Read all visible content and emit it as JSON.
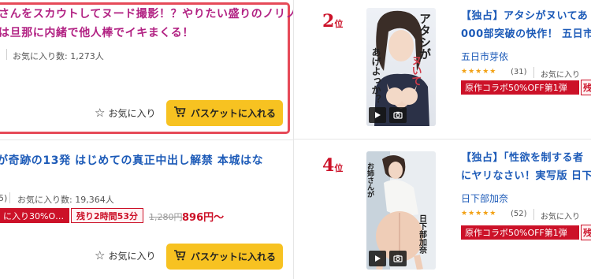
{
  "left_items": [
    {
      "title_line1": "さんをスカウトしてヌード撮影！？やりたい盛りのノリノ",
      "title_line2": "は旦那に内緒で他人棒でイキまくる！",
      "fav_count_label": "お気に入り数: 1,273人",
      "fav_button_label": "お気に入り",
      "basket_label": "バスケットに入れる"
    },
    {
      "title_line1": "が奇跡の13発 はじめての真正中出し解禁 本城はな",
      "rating_count_fragment": "5)",
      "fav_count_label": "お気に入り数: 19,364人",
      "discount_badge": "に入り30%O…",
      "time_left_badge": "残り2時間53分",
      "original_price": "1,280円",
      "sale_price": "896円〜",
      "fav_button_label": "お気に入り",
      "basket_label": "バスケットに入れる"
    }
  ],
  "right_items": [
    {
      "rank_number": "2",
      "rank_suffix": "位",
      "title_line1": "【独占】アタシがヌいてあ",
      "title_line2": "000部突破の快作！ 五日市",
      "actress": "五日市芽依",
      "stars": "★★★★★",
      "rating_count": "(31)",
      "fav_label": "お気に入り",
      "promo_label": "原作コラボ50%OFF第1弾",
      "promo_tag": "残",
      "cover_text": "アタシがヌいてあげよっか？"
    },
    {
      "rank_number": "4",
      "rank_suffix": "位",
      "title_line1": "【独占】「性欲を制する者",
      "title_line2": "にヤリなさい！実写版 日下",
      "actress": "日下部加奈",
      "stars": "★★★★★",
      "rating_count": "(52)",
      "fav_label": "お気に入り",
      "promo_label": "原作コラボ50%OFF第1弾",
      "promo_tag": "残",
      "cover_text": "日下部加奈"
    }
  ],
  "icons": {
    "star_outline": "☆",
    "cart": "🛒",
    "play": "▶",
    "camera": "📷",
    "heart": "♡"
  },
  "colors": {
    "accent_red": "#cc1128",
    "link_blue": "#1d5bb8",
    "title_magenta": "#b22283",
    "basket_yellow": "#f7c221",
    "highlight_border": "#e64a58"
  }
}
